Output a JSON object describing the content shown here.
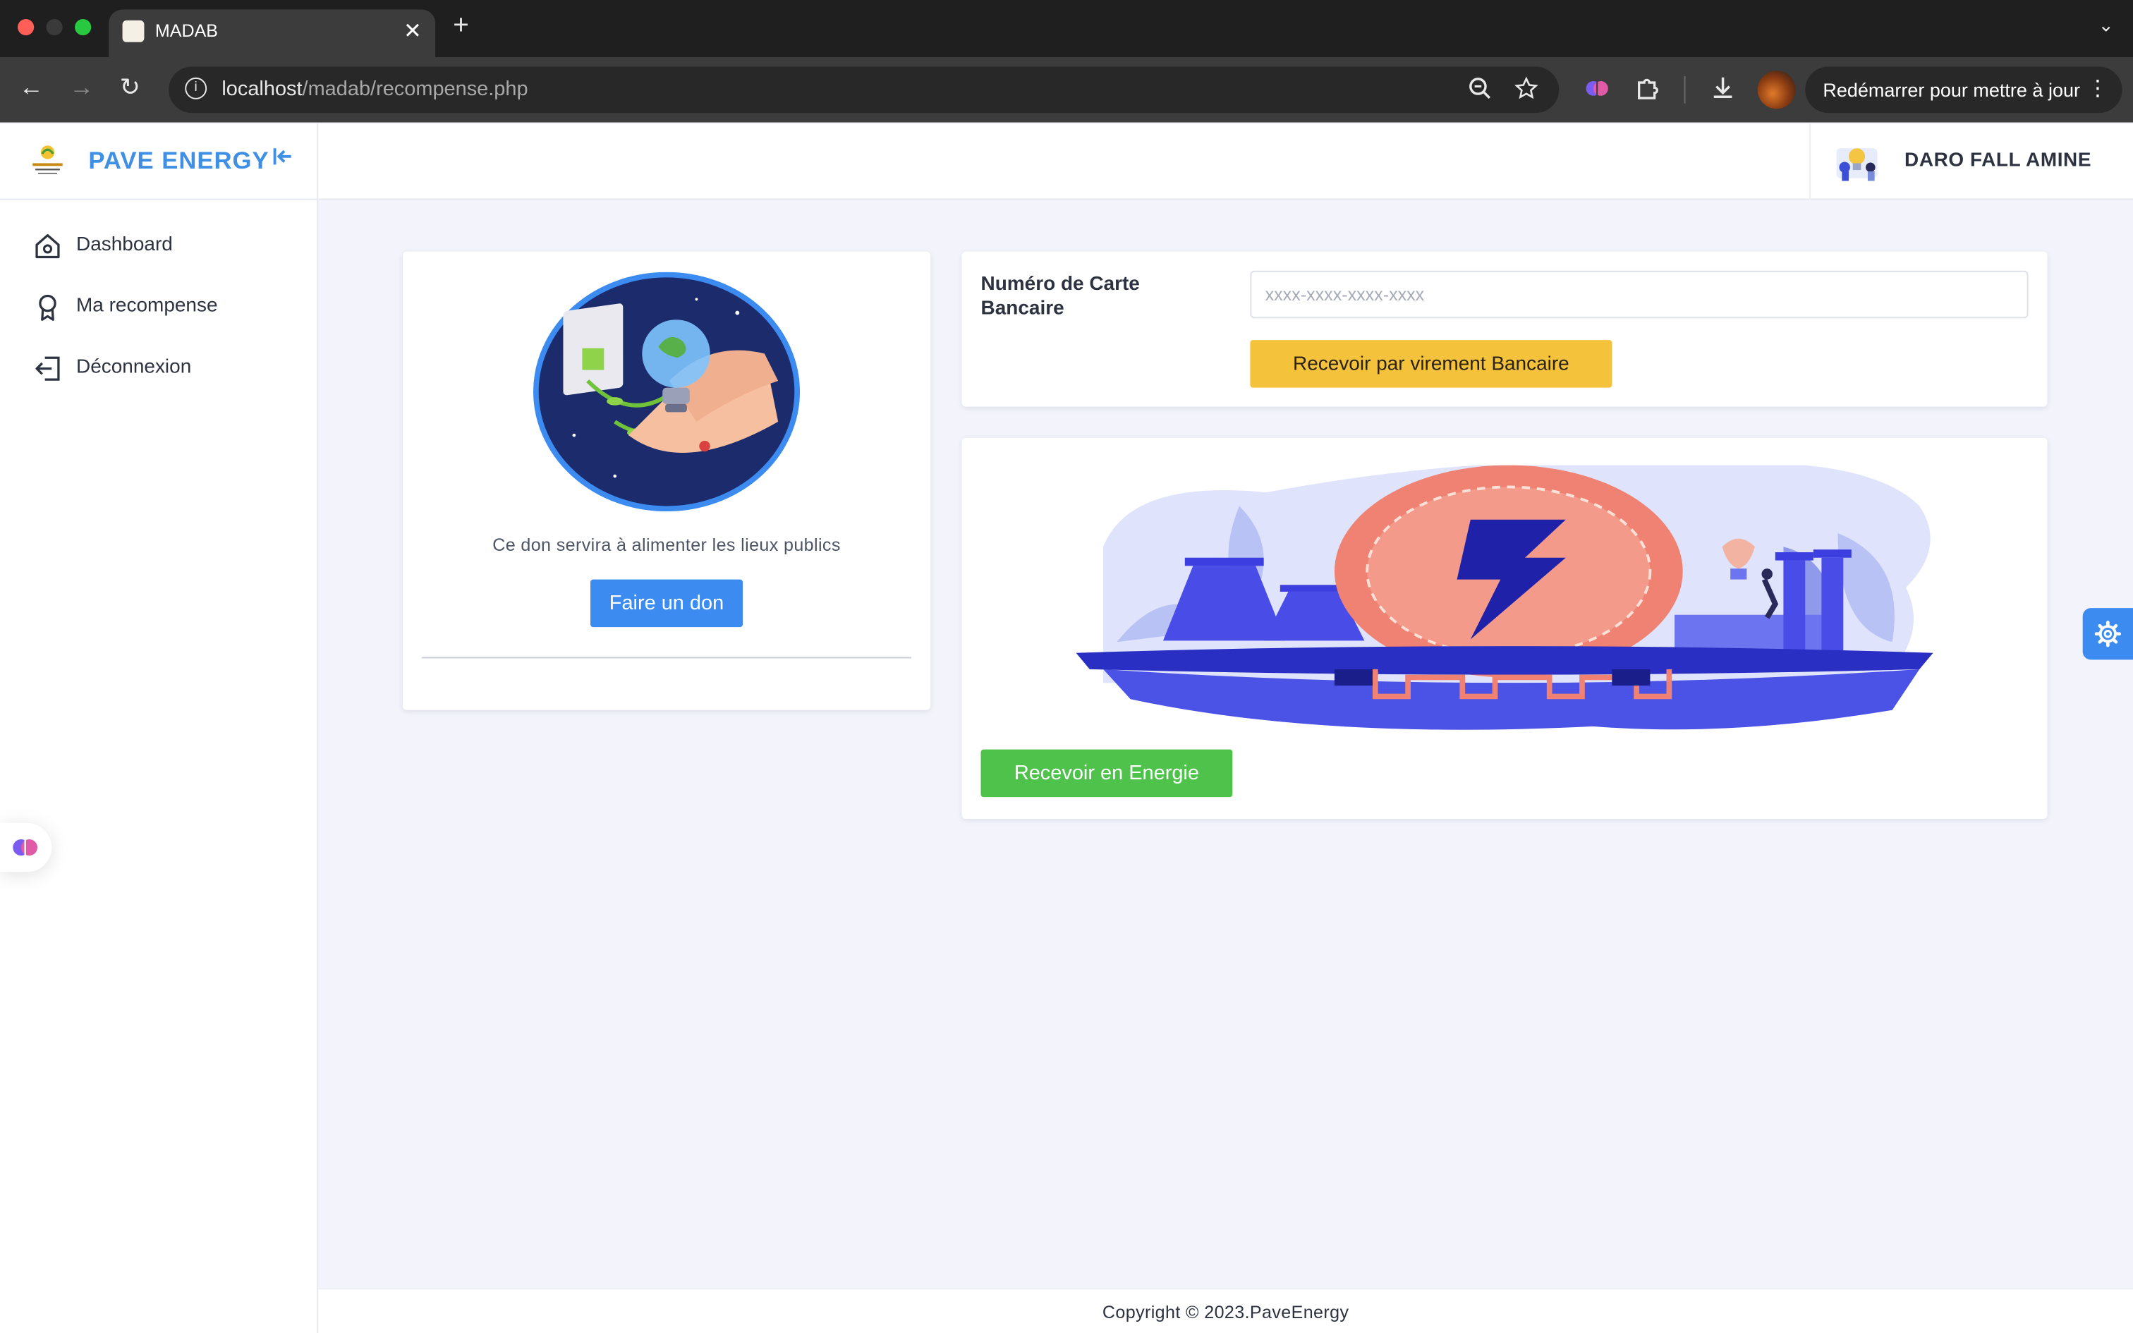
{
  "browser": {
    "tab_title": "MADAB",
    "url_host": "localhost",
    "url_path": "/madab/recompense.php",
    "restart_label": "Redémarrer pour mettre à jour",
    "traffic_colors": [
      "#ff5f57",
      "#3a3a3a",
      "#28c840"
    ]
  },
  "sidebar": {
    "brand": "PAVE ENERGY",
    "brand_color": "#3f8fe4",
    "items": [
      {
        "label": "Dashboard",
        "icon": "home-icon"
      },
      {
        "label": "Ma recompense",
        "icon": "award-icon"
      },
      {
        "label": "Déconnexion",
        "icon": "logout-icon"
      }
    ]
  },
  "header": {
    "user_name": "DARO FALL AMINE"
  },
  "donation": {
    "description": "Ce don servira à alimenter les lieux publics",
    "button_label": "Faire un don",
    "button_color": "#3b8bf0"
  },
  "bank": {
    "label": "Numéro de Carte Bancaire",
    "placeholder": "xxxx-xxxx-xxxx-xxxx",
    "value": "",
    "button_label": "Recevoir par virement Bancaire",
    "button_color": "#f5c23c"
  },
  "energy": {
    "button_label": "Recevoir en Energie",
    "button_color": "#4ec24a"
  },
  "footer": {
    "copyright": "Copyright © 2023.PaveEnergy"
  }
}
